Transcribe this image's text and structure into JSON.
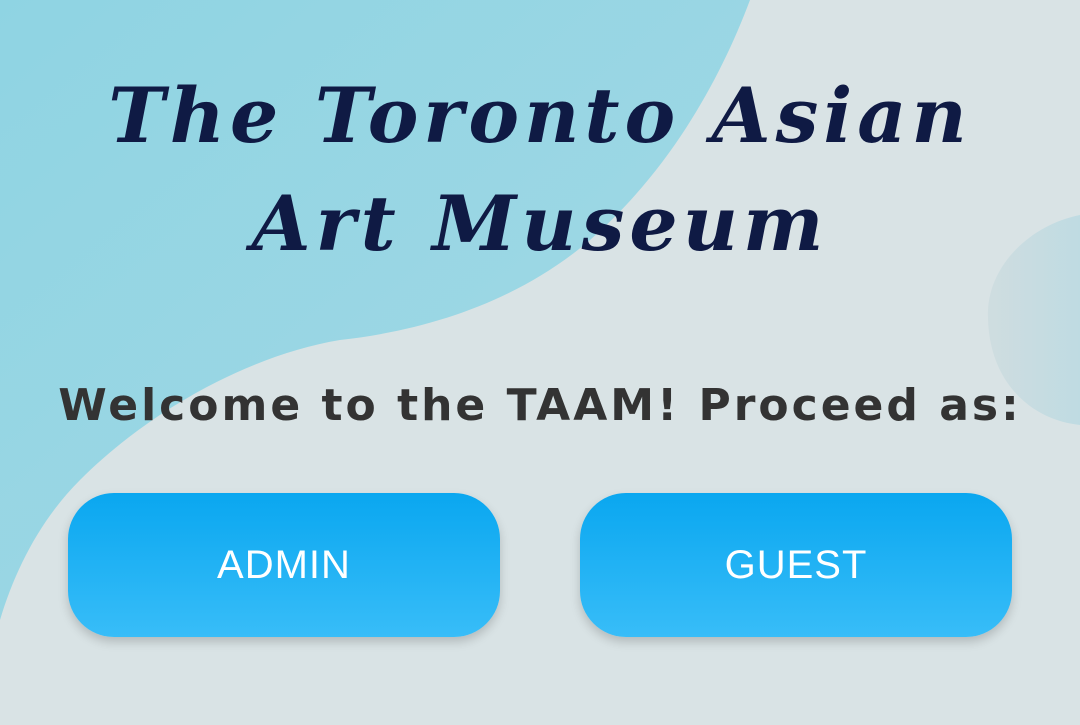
{
  "header": {
    "title_line1": "The Toronto Asian",
    "title_line2": "Art Museum"
  },
  "welcome": {
    "text": "Welcome to the TAAM! Proceed as:"
  },
  "buttons": {
    "admin_label": "ADMIN",
    "guest_label": "GUEST"
  },
  "colors": {
    "background": "#d9e3e5",
    "blob": "#99d6e2",
    "title": "#0f1a44",
    "welcome_text": "#333333",
    "button_top": "#0aa7f0",
    "button_bottom": "#38bdf8",
    "button_text": "#ffffff"
  }
}
